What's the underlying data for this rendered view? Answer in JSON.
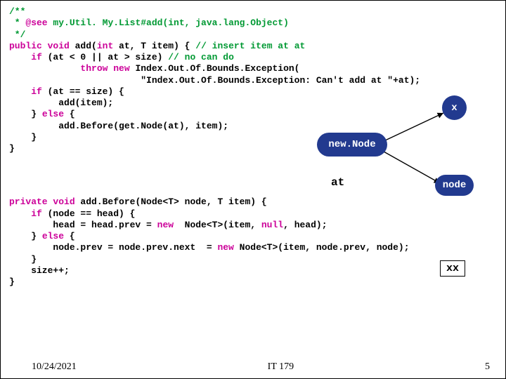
{
  "code1": {
    "l01": "/**",
    "l02_a": " * ",
    "l02_b": "@see",
    "l02_c": " my.Util. My.List#add(int, java.lang.Object)",
    "l03": " */",
    "l04_a": "public void",
    "l04_b": " add(",
    "l04_c": "int",
    "l04_d": " at, T item) { ",
    "l04_e": "// insert item at at",
    "l05_a": "    if",
    "l05_b": " (at < 0 || at > size) ",
    "l05_c": "// no can do",
    "l06_a": "             throw new",
    "l06_b": " Index.Out.Of.Bounds.Exception(",
    "l07": "                        \"Index.Out.Of.Bounds.Exception: Can't add at \"+at);",
    "l08_a": "    if",
    "l08_b": " (at == size) {",
    "l09": "         add(item);",
    "l10_a": "    } ",
    "l10_b": "else",
    "l10_c": " {",
    "l11": "         add.Before(get.Node(at), item);",
    "l12": "",
    "l13": "    }",
    "l14": "}"
  },
  "code2": {
    "l01_a": "private void",
    "l01_b": " add.Before(Node<T> node, T item) {",
    "l02_a": "    if",
    "l02_b": " (node == head) {",
    "l03_a": "        head = head.prev = ",
    "l03_b": "new",
    "l03_c": "  Node<T>(item, ",
    "l03_d": "null",
    "l03_e": ", head);",
    "l04_a": "    } ",
    "l04_b": "else",
    "l04_c": " {",
    "l05_a": "        node.prev = node.prev.next  = ",
    "l05_b": "new",
    "l05_c": " Node<T>(item, node.prev, node);",
    "l06": "    }",
    "l07": "    size++;",
    "l08": "}"
  },
  "diagram": {
    "x": "x",
    "newNode": "new.Node",
    "at": "at",
    "node": "node",
    "xx": "xx"
  },
  "footer": {
    "date": "10/24/2021",
    "course": "IT 179",
    "page": "5"
  }
}
